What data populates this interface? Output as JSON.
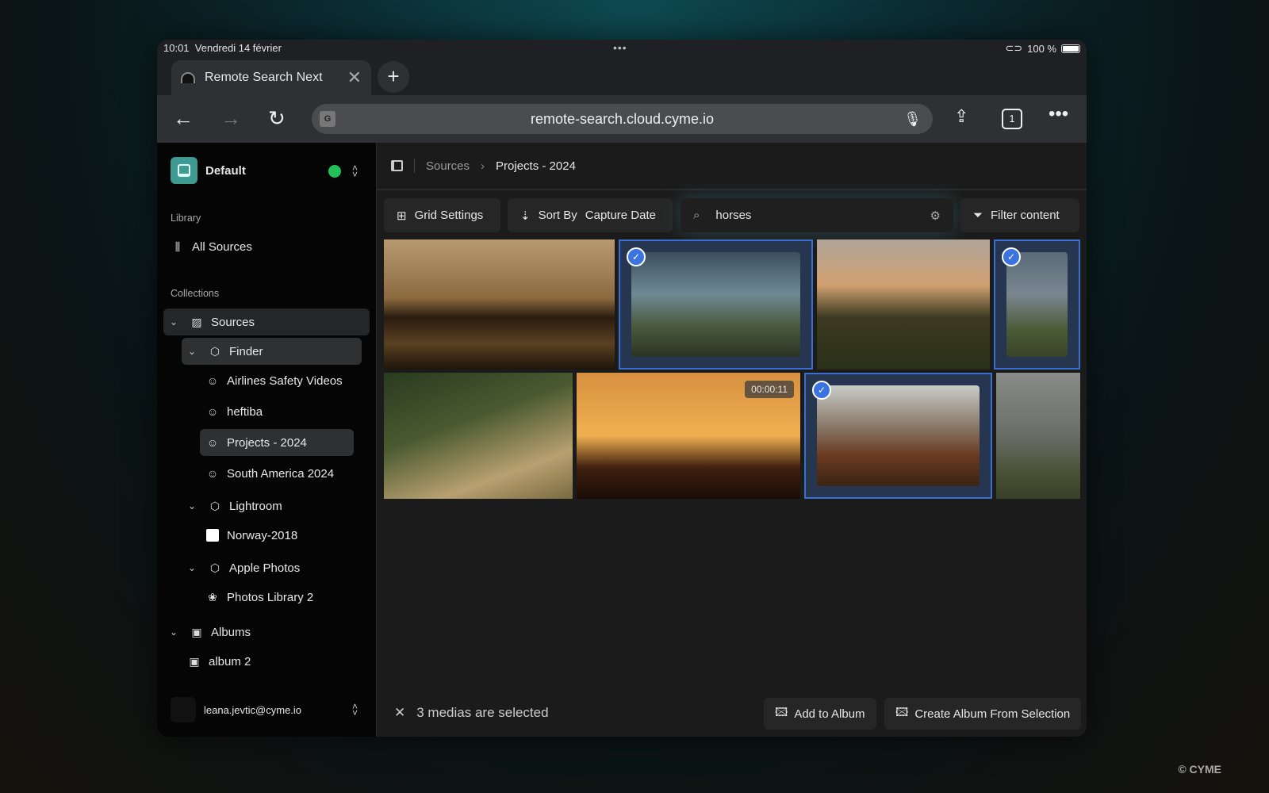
{
  "status": {
    "time": "10:01",
    "date": "Vendredi 14 février",
    "battery": "100 %",
    "battery_level": 100
  },
  "browser": {
    "tab_title": "Remote Search Next",
    "url": "remote-search.cloud.cyme.io",
    "tab_count": "1"
  },
  "sidebar": {
    "workspace": "Default",
    "workspace_status_color": "#23c05a",
    "library_label": "Library",
    "all_sources": "All Sources",
    "collections_label": "Collections",
    "tree": [
      {
        "label": "Sources"
      },
      {
        "label": "Finder"
      },
      {
        "label": "Airlines Safety Videos"
      },
      {
        "label": "heftiba"
      },
      {
        "label": "Projects - 2024"
      },
      {
        "label": "South America 2024"
      },
      {
        "label": "Lightroom"
      },
      {
        "label": "Norway-2018"
      },
      {
        "label": "Apple Photos"
      },
      {
        "label": "Photos Library 2"
      },
      {
        "label": "Albums"
      },
      {
        "label": "album 2"
      }
    ],
    "user": "leana.jevtic@cyme.io"
  },
  "main": {
    "breadcrumb": [
      "Sources",
      "Projects - 2024"
    ],
    "toolbar": {
      "grid_settings": "Grid Settings",
      "sort_by": "Sort By",
      "sort_value": "Capture Date",
      "search_value": "horses",
      "filter": "Filter content"
    },
    "tiles": [
      {
        "selected": false
      },
      {
        "selected": true
      },
      {
        "selected": false
      },
      {
        "selected": true
      },
      {
        "selected": false
      },
      {
        "selected": false,
        "duration": "00:00:11"
      },
      {
        "selected": true
      },
      {
        "selected": false
      }
    ],
    "selection_text": "3 medias are selected",
    "add_to_album": "Add to Album",
    "create_album": "Create Album From Selection"
  },
  "accent": "#3b74e0",
  "watermark": "© CYME"
}
